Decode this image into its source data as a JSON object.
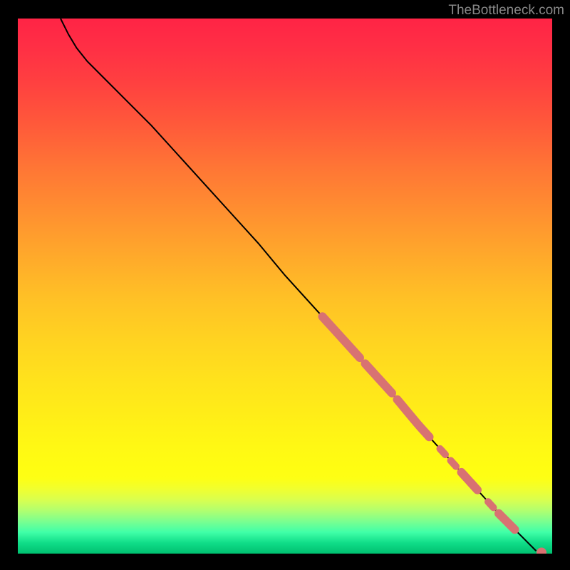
{
  "watermark": "TheBottleneck.com",
  "chart_data": {
    "type": "line",
    "title": "",
    "xlabel": "",
    "ylabel": "",
    "xlim": [
      0,
      100
    ],
    "ylim": [
      0,
      100
    ],
    "curve_points": [
      {
        "x": 8,
        "y": 100
      },
      {
        "x": 9.5,
        "y": 97
      },
      {
        "x": 11,
        "y": 94.5
      },
      {
        "x": 13,
        "y": 92
      },
      {
        "x": 16,
        "y": 89
      },
      {
        "x": 20,
        "y": 85
      },
      {
        "x": 25,
        "y": 80
      },
      {
        "x": 30,
        "y": 74.5
      },
      {
        "x": 35,
        "y": 69
      },
      {
        "x": 40,
        "y": 63.5
      },
      {
        "x": 45,
        "y": 58
      },
      {
        "x": 50,
        "y": 52
      },
      {
        "x": 55,
        "y": 46.5
      },
      {
        "x": 60,
        "y": 41
      },
      {
        "x": 65,
        "y": 35.5
      },
      {
        "x": 70,
        "y": 30
      },
      {
        "x": 75,
        "y": 24
      },
      {
        "x": 80,
        "y": 18.5
      },
      {
        "x": 85,
        "y": 13
      },
      {
        "x": 90,
        "y": 7.5
      },
      {
        "x": 95,
        "y": 2.5
      },
      {
        "x": 97,
        "y": 0.5
      }
    ],
    "highlighted_segments": [
      {
        "x_start": 57,
        "x_end": 64,
        "thick": true
      },
      {
        "x_start": 65,
        "x_end": 70,
        "thick": true
      },
      {
        "x_start": 71,
        "x_end": 77,
        "thick": true
      },
      {
        "x_start": 79,
        "x_end": 80,
        "thick": false
      },
      {
        "x_start": 81,
        "x_end": 82,
        "thick": false
      },
      {
        "x_start": 83,
        "x_end": 86,
        "thick": true
      },
      {
        "x_start": 88,
        "x_end": 89,
        "thick": false
      },
      {
        "x_start": 90,
        "x_end": 93,
        "thick": true
      }
    ],
    "end_point": {
      "x": 98,
      "y": 0.2,
      "r": 7
    }
  },
  "colors": {
    "background": "#000000",
    "point_fill": "#d87272",
    "curve_stroke": "#000000"
  }
}
